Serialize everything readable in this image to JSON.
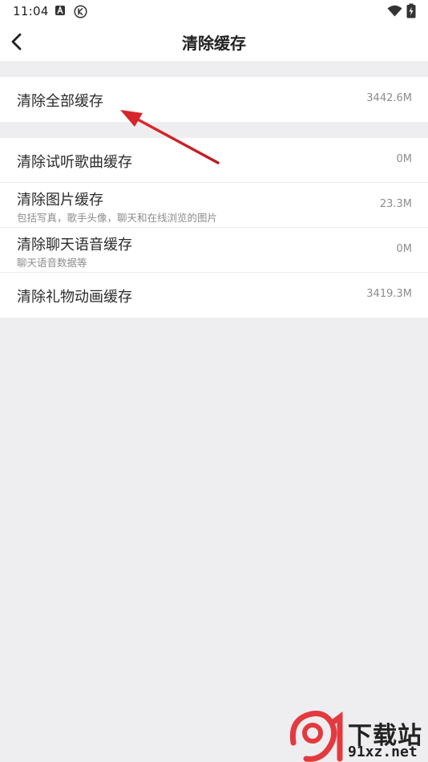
{
  "status_bar": {
    "time": "11:04"
  },
  "nav": {
    "title": "清除缓存"
  },
  "group_all": {
    "items": [
      {
        "title": "清除全部缓存",
        "value": "3442.6M"
      }
    ]
  },
  "group_detail": {
    "items": [
      {
        "title": "清除试听歌曲缓存",
        "subtitle": "",
        "value": "0M"
      },
      {
        "title": "清除图片缓存",
        "subtitle": "包括写真，歌手头像，聊天和在线浏览的图片",
        "value": "23.3M"
      },
      {
        "title": "清除聊天语音缓存",
        "subtitle": "聊天语音数据等",
        "value": "0M"
      },
      {
        "title": "清除礼物动画缓存",
        "subtitle": "",
        "value": "3419.3M"
      }
    ]
  },
  "watermark": {
    "site_cn": "下载站",
    "site_en": "91xz.net"
  },
  "colors": {
    "arrow": "#d7262b",
    "background": "#eeeef0"
  },
  "icons": [
    "android-icon",
    "k-icon",
    "wifi-icon",
    "battery-charging-icon",
    "back-icon"
  ]
}
